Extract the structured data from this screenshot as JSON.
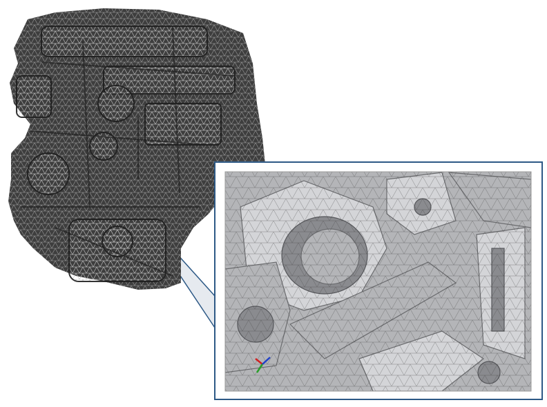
{
  "figure": {
    "engine_mesh": {
      "fill_color": "#3e3e3e",
      "mesh_color": "#b9b9b9"
    },
    "callout": {
      "frame_color": "#2c5885",
      "connector_fill": "#e6eaef",
      "background_color": "#ffffff"
    },
    "detail_view": {
      "surface_color": "#b4b5b8",
      "dark_surface_color": "#8a8b8f",
      "light_surface_color": "#d4d5d8",
      "mesh_color": "#404040"
    },
    "axis_triad": {
      "icon": "xyz-axis-triad-icon",
      "x_color": "#d02020",
      "y_color": "#2aa02a",
      "z_color": "#2040c8"
    }
  }
}
